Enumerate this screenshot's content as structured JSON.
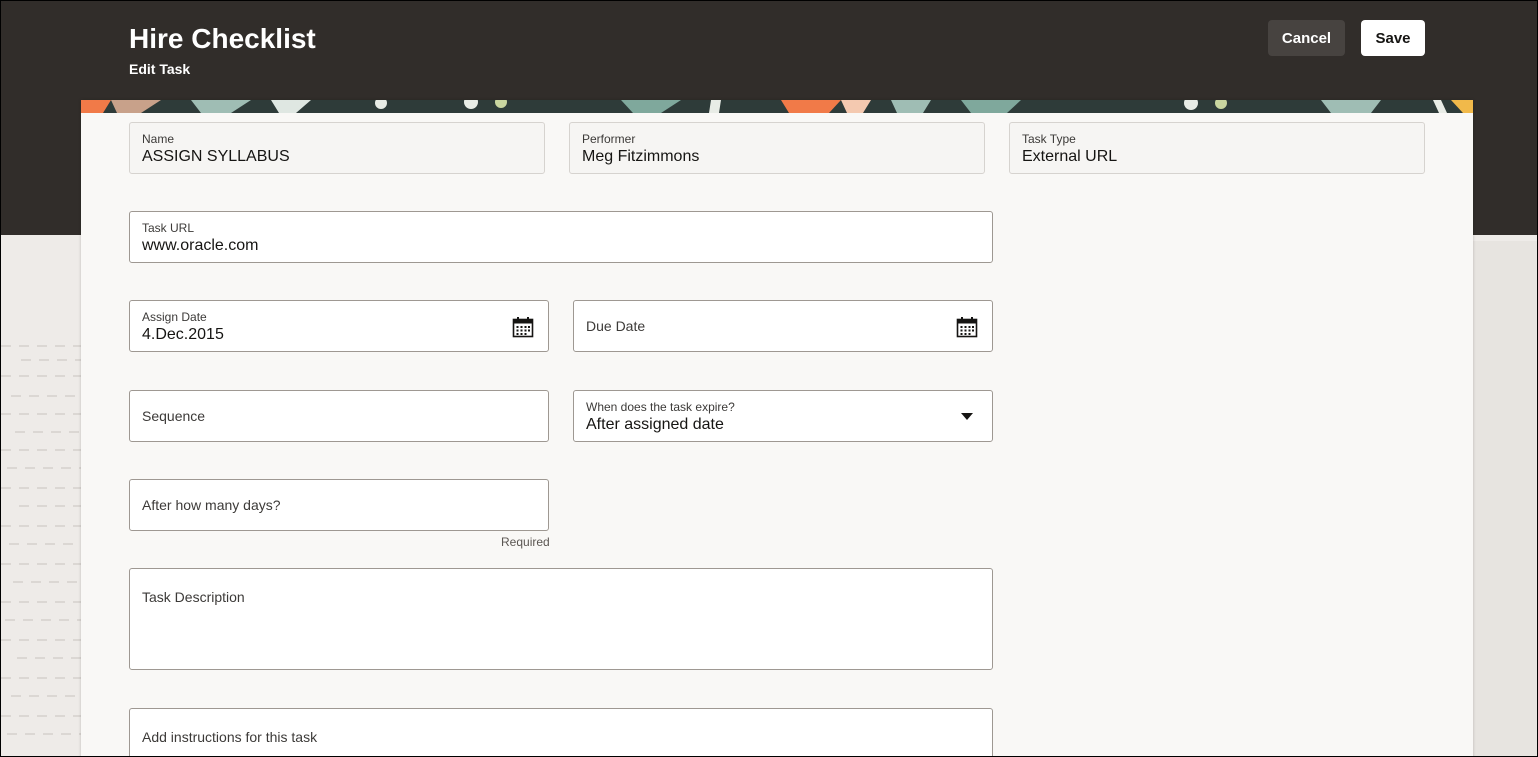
{
  "header": {
    "title": "Hire Checklist",
    "subtitle": "Edit Task",
    "cancel_label": "Cancel",
    "save_label": "Save"
  },
  "form": {
    "name": {
      "label": "Name",
      "value": "ASSIGN SYLLABUS"
    },
    "performer": {
      "label": "Performer",
      "value": "Meg Fitzimmons"
    },
    "task_type": {
      "label": "Task Type",
      "value": "External URL"
    },
    "task_url": {
      "label": "Task URL",
      "value": "www.oracle.com"
    },
    "assign_date": {
      "label": "Assign Date",
      "value": "4.Dec.2015",
      "icon": "calendar-icon"
    },
    "due_date": {
      "placeholder": "Due Date",
      "icon": "calendar-icon"
    },
    "sequence": {
      "placeholder": "Sequence"
    },
    "expire": {
      "label": "When does the task expire?",
      "value": "After assigned date",
      "icon": "caret-down-icon"
    },
    "days": {
      "placeholder": "After how many days?",
      "helper": "Required"
    },
    "description": {
      "placeholder": "Task Description"
    },
    "instructions": {
      "placeholder": "Add instructions for this task"
    }
  },
  "colors": {
    "header_bg": "#312d2a",
    "panel_bg": "#f9f8f6",
    "cancel_bg": "#474340",
    "save_bg": "#ffffff"
  }
}
